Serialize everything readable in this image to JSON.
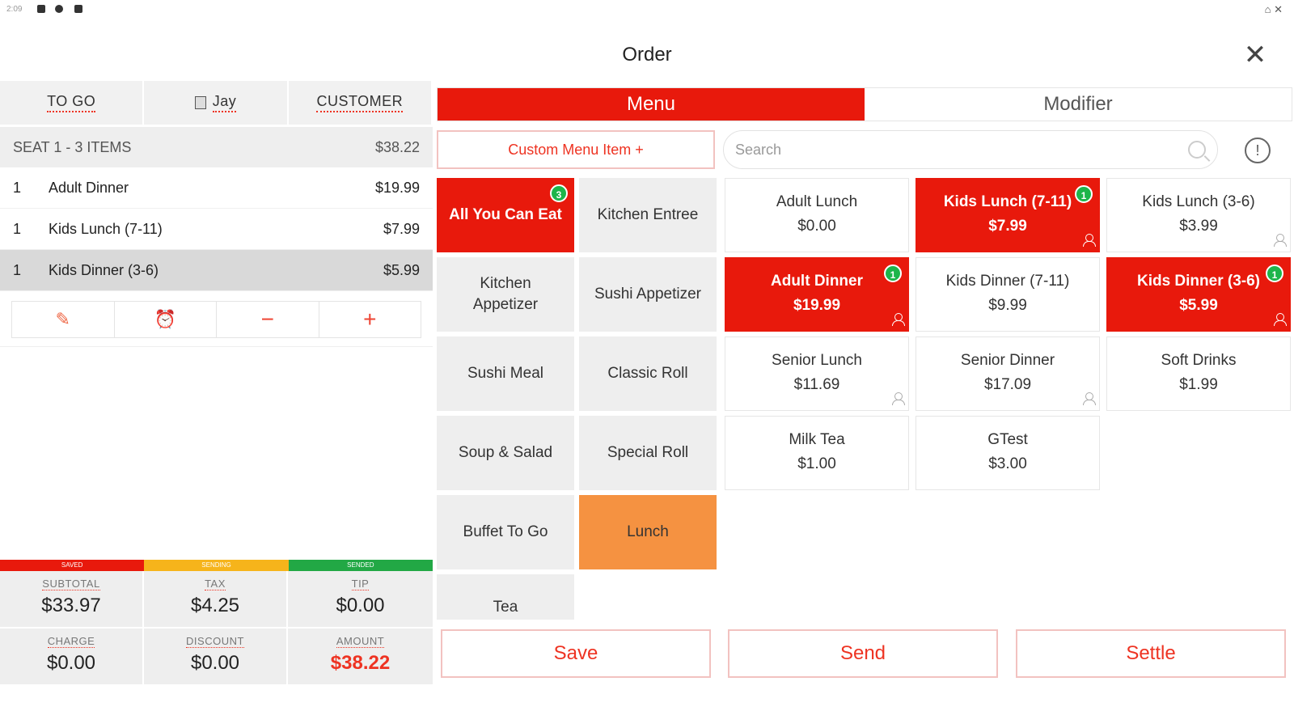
{
  "statusbar": {
    "time": "2:09",
    "right": "⌂ ✕"
  },
  "header": {
    "title": "Order",
    "close": "✕"
  },
  "left": {
    "tabs": [
      "TO GO",
      "Jay",
      "CUSTOMER"
    ],
    "seat": {
      "label": "SEAT 1 - 3 ITEMS",
      "total": "$38.22"
    },
    "items": [
      {
        "qty": "1",
        "name": "Adult Dinner",
        "price": "$19.99"
      },
      {
        "qty": "1",
        "name": "Kids Lunch (7-11)",
        "price": "$7.99"
      },
      {
        "qty": "1",
        "name": "Kids Dinner (3-6)",
        "price": "$5.99"
      }
    ],
    "actions": {
      "edit": "✎",
      "timer": "⏰",
      "minus": "−",
      "plus": "+"
    },
    "status_strip": [
      "SAVED",
      "SENDING",
      "SENDED"
    ],
    "totals": {
      "subtotal_label": "SUBTOTAL",
      "subtotal": "$33.97",
      "tax_label": "TAX",
      "tax": "$4.25",
      "tip_label": "TIP",
      "tip": "$0.00",
      "charge_label": "CHARGE",
      "charge": "$0.00",
      "discount_label": "DISCOUNT",
      "discount": "$0.00",
      "amount_label": "AMOUNT",
      "amount": "$38.22"
    }
  },
  "menu_tabs": {
    "menu": "Menu",
    "modifier": "Modifier"
  },
  "custom_item": "Custom Menu Item  +",
  "search": {
    "placeholder": "Search",
    "value": ""
  },
  "info_icon": "!",
  "categories": [
    {
      "name": "All You Can Eat",
      "badge": "3"
    },
    {
      "name": "Kitchen Entree"
    },
    {
      "name": "Kitchen Appetizer"
    },
    {
      "name": "Sushi Appetizer"
    },
    {
      "name": "Sushi Meal"
    },
    {
      "name": "Classic Roll"
    },
    {
      "name": "Soup & Salad"
    },
    {
      "name": "Special Roll"
    },
    {
      "name": "Buffet To Go"
    },
    {
      "name": "Lunch"
    },
    {
      "name": "Tea"
    }
  ],
  "menu_items": [
    {
      "name": "Adult Lunch",
      "price": "$0.00"
    },
    {
      "name": "Kids Lunch (7-11)",
      "price": "$7.99",
      "badge": "1"
    },
    {
      "name": "Kids Lunch (3-6)",
      "price": "$3.99"
    },
    {
      "name": "Adult Dinner",
      "price": "$19.99",
      "badge": "1"
    },
    {
      "name": "Kids Dinner (7-11)",
      "price": "$9.99"
    },
    {
      "name": "Kids Dinner (3-6)",
      "price": "$5.99",
      "badge": "1"
    },
    {
      "name": "Senior Lunch",
      "price": "$11.69"
    },
    {
      "name": "Senior Dinner",
      "price": "$17.09"
    },
    {
      "name": "Soft Drinks",
      "price": "$1.99"
    },
    {
      "name": "Milk Tea",
      "price": "$1.00"
    },
    {
      "name": "GTest",
      "price": "$3.00"
    }
  ],
  "buttons": {
    "save": "Save",
    "send": "Send",
    "settle": "Settle"
  },
  "colors": {
    "accent_red": "#e8190c",
    "green_badge": "#1db54a",
    "orange": "#f59241",
    "saved": "#e8190c",
    "sending": "#f6b41b",
    "sended": "#22a845"
  }
}
